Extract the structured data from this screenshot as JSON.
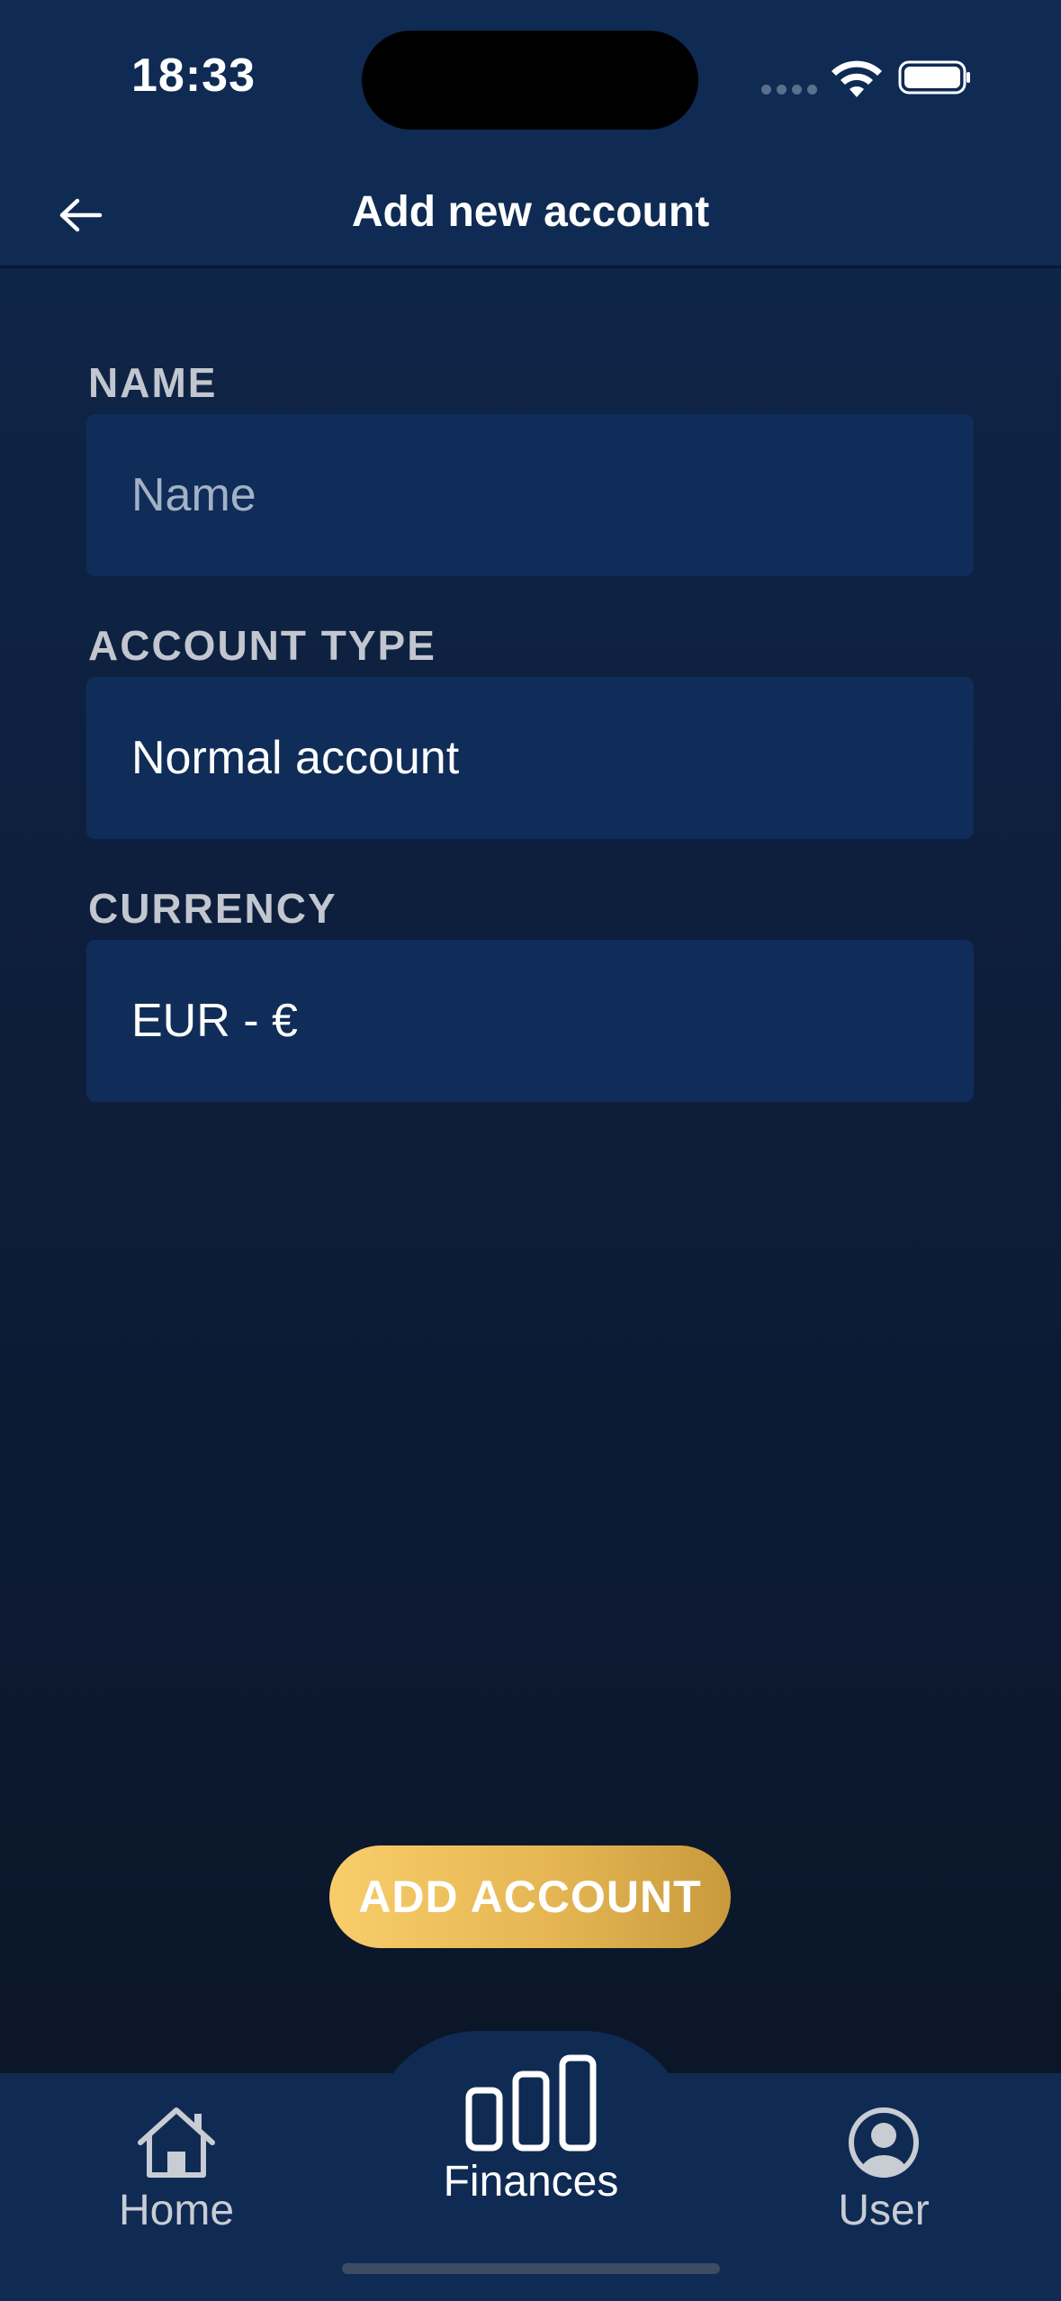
{
  "status": {
    "time": "18:33"
  },
  "header": {
    "title": "Add new account"
  },
  "form": {
    "name": {
      "label": "NAME",
      "placeholder": "Name",
      "value": ""
    },
    "account_type": {
      "label": "ACCOUNT TYPE",
      "value": "Normal account"
    },
    "currency": {
      "label": "CURRENCY",
      "value": "EUR - €"
    }
  },
  "actions": {
    "add_account_label": "ADD ACCOUNT"
  },
  "tabs": [
    {
      "label": "Home",
      "icon": "home-icon",
      "active": false
    },
    {
      "label": "Finances",
      "icon": "bar-chart-icon",
      "active": true
    },
    {
      "label": "User",
      "icon": "user-icon",
      "active": false
    }
  ],
  "colors": {
    "background": "#0d1d3a",
    "surface": "#0f2d58",
    "accent_gold": "#e5b653",
    "label_gray": "#c2c6cf"
  }
}
